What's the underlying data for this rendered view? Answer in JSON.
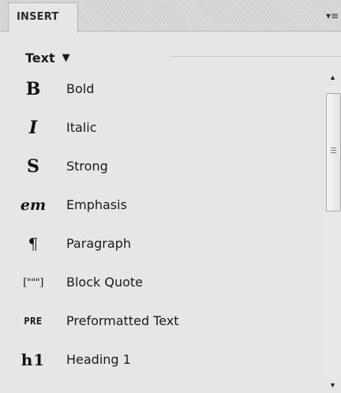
{
  "panel": {
    "tab_label": "INSERT",
    "menu_icon": "panel-menu-icon",
    "menu_glyph": "▾≡"
  },
  "category": {
    "label": "Text",
    "caret": "▼"
  },
  "items": [
    {
      "icon": "bold-icon",
      "glyph": "B",
      "label": "Bold"
    },
    {
      "icon": "italic-icon",
      "glyph": "I",
      "label": "Italic"
    },
    {
      "icon": "strong-icon",
      "glyph": "S",
      "label": "Strong"
    },
    {
      "icon": "emphasis-icon",
      "glyph": "em",
      "label": "Emphasis"
    },
    {
      "icon": "paragraph-icon",
      "glyph": "¶",
      "label": "Paragraph"
    },
    {
      "icon": "block-quote-icon",
      "glyph": "[\"\"\"]",
      "label": "Block Quote"
    },
    {
      "icon": "preformatted-icon",
      "glyph": "PRE",
      "label": "Preformatted Text"
    },
    {
      "icon": "heading-1-icon",
      "glyph": "h1",
      "label": "Heading 1"
    }
  ],
  "scrollbar": {
    "up_glyph": "▲",
    "down_glyph": "▼"
  }
}
